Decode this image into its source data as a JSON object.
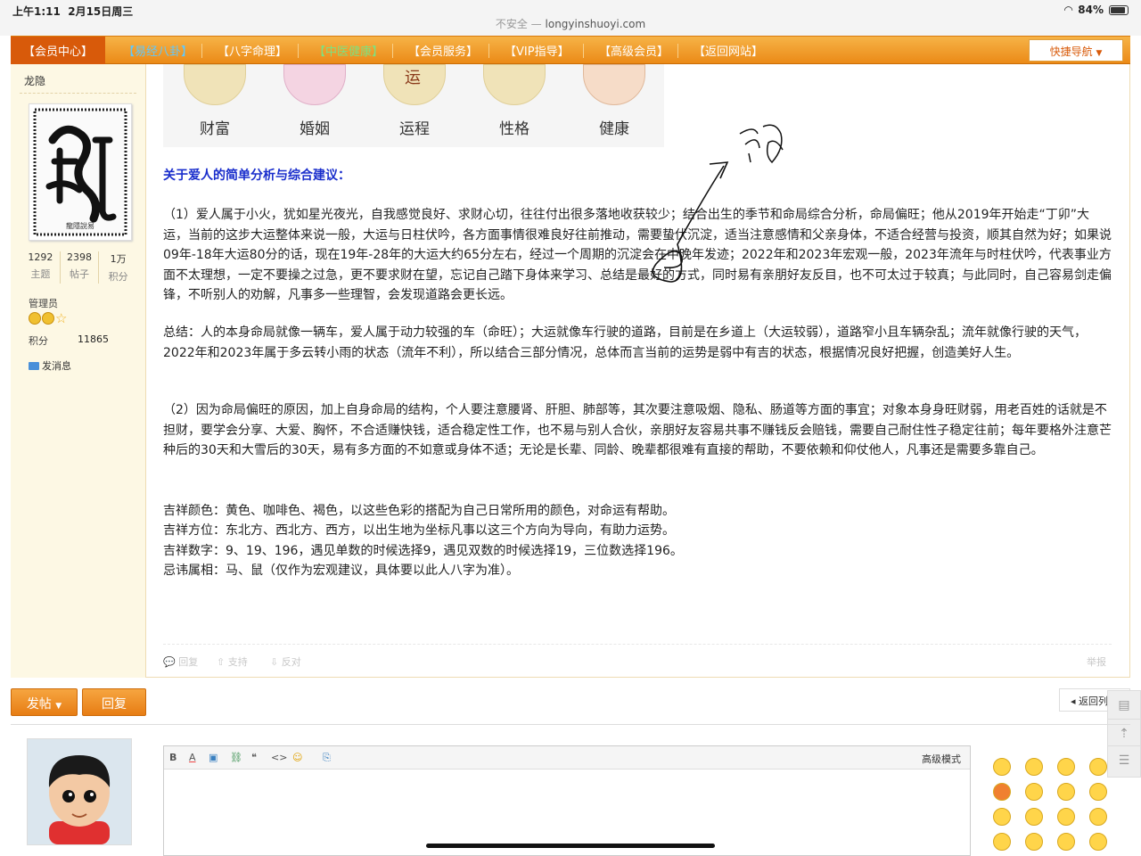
{
  "status": {
    "time": "上午1:11",
    "date": "2月15日周三",
    "battery": "84%",
    "insecure": "不安全 —",
    "url": "longyinshuoyi.com"
  },
  "nav": {
    "items": [
      "【会员中心】",
      "【易经八卦】",
      "【八字命理】",
      "【中医健康】",
      "【会员服务】",
      "【VIP指导】",
      "【高级会员】",
      "【返回网站】"
    ],
    "colors": [
      "#ffffff",
      "#5ec8ff",
      "#ffffff",
      "#7fe07f",
      "#ffffff",
      "#ffffff",
      "#ffffff",
      "#ffffff"
    ],
    "quick": "快捷导航"
  },
  "user": {
    "name": "龙隐",
    "stats": [
      {
        "num": "1292",
        "label": "主题"
      },
      {
        "num": "2398",
        "label": "帖子"
      },
      {
        "num": "1万",
        "label": "积分"
      }
    ],
    "role": "管理员",
    "points_label": "积分",
    "points_value": "11865",
    "send_msg": "发消息"
  },
  "categories": [
    "财富",
    "婚姻",
    "运程",
    "性格",
    "健康"
  ],
  "section_title": "关于爱人的简单分析与综合建议：",
  "paragraphs": [
    "（1）爱人属于小火，犹如星光夜光，自我感觉良好、求财心切，往往付出很多落地收获较少；结合出生的季节和命局综合分析，命局偏旺；他从2019年开始走“丁卯”大运，当前的这步大运整体来说一般，大运与日柱伏吟，各方面事情很难良好往前推动，需要蛰伏沉淀，适当注意感情和父亲身体，不适合经营与投资，顺其自然为好；如果说09年-18年大运80分的话，现在19年-28年的大运大约65分左右，经过一个周期的沉淀会在中晚年发迹；2022年和2023年宏观一般，2023年流年与时柱伏吟，代表事业方面不太理想，一定不要操之过急，更不要求财在望，忘记自己踏下身体来学习、总结是最好的方式，同时易有亲朋好友反目，也不可太过于较真；与此同时，自己容易剑走偏锋，不听别人的劝解，凡事多一些理智，会发现道路会更长远。",
    "总结：人的本身命局就像一辆车，爱人属于动力较强的车（命旺）；大运就像车行驶的道路，目前是在乡道上（大运较弱），道路窄小且车辆杂乱；流年就像行驶的天气，2022年和2023年属于多云转小雨的状态（流年不利），所以结合三部分情况，总体而言当前的运势是弱中有吉的状态，根据情况良好把握，创造美好人生。",
    "（2）因为命局偏旺的原因，加上自身命局的结构，个人要注意腰肾、肝胆、肺部等，其次要注意吸烟、隐私、肠道等方面的事宜；对象本身身旺财弱，用老百姓的话就是不担财，要学会分享、大爱、胸怀，不合适赚快钱，适合稳定性工作，也不易与别人合伙，亲朋好友容易共事不赚钱反会赔钱，需要自己耐住性子稳定往前；每年要格外注意芒种后的30天和大雪后的30天，易有多方面的不如意或身体不适；无论是长辈、同龄、晚辈都很难有直接的帮助，不要依赖和仰仗他人，凡事还是需要多靠自己。"
  ],
  "lucky": [
    "吉祥颜色：黄色、咖啡色、褐色，以这些色彩的搭配为自己日常所用的颜色，对命运有帮助。",
    "吉祥方位：东北方、西北方、西方，以出生地为坐标凡事以这三个方向为导向，有助力运势。",
    "吉祥数字：9、19、196，遇见单数的时候选择9，遇见双数的时候选择19，三位数选择196。",
    "忌讳属相：马、鼠（仅作为宏观建议，具体要以此人八字为准）。"
  ],
  "actions": {
    "reply": "回复",
    "support": "支持",
    "oppose": "反对",
    "report": "举报"
  },
  "buttons": {
    "post": "发帖",
    "reply": "回复",
    "back": "返回列"
  },
  "editor": {
    "advanced": "高级模式",
    "tools": [
      "B",
      "A",
      "▣",
      "⛓",
      "❝",
      "<>",
      "☺",
      "⎘"
    ]
  },
  "accent": "#eb8a17"
}
